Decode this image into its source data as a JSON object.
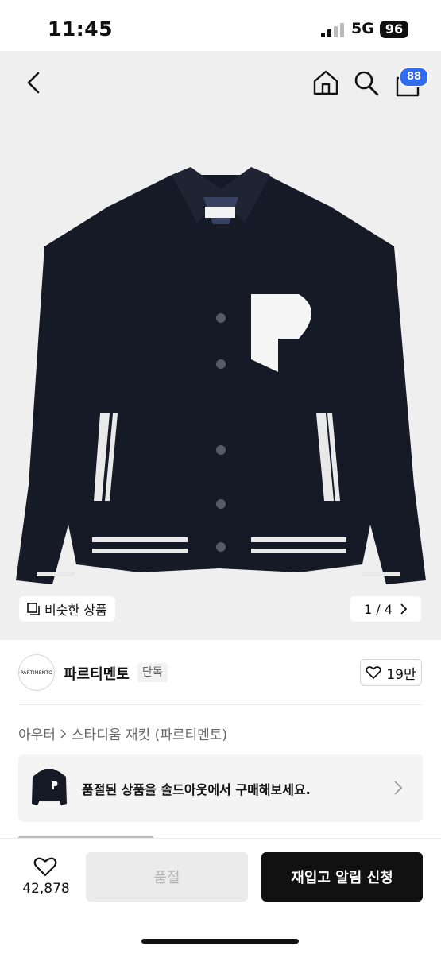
{
  "status_bar": {
    "time": "11:45",
    "network": "5G",
    "battery": "96"
  },
  "nav": {
    "cart_count": "88"
  },
  "gallery": {
    "similar_label": "비슷한 상품",
    "counter": "1 / 4"
  },
  "brand": {
    "name": "파르티멘토",
    "logo_text": "PARTIMENTO",
    "badge": "단독",
    "likes": "19만"
  },
  "breadcrumb": {
    "category": "아우터",
    "product": "스타디움 재킷 (파르티멘토)"
  },
  "soldout_banner": {
    "text": "품절된 상품을 솔드아웃에서 구매해보세요."
  },
  "bottom_bar": {
    "wish_count": "42,878",
    "soldout_label": "품절",
    "restock_label": "재입고 알림 신청"
  },
  "colors": {
    "accent": "#2f6cf0",
    "primary_button": "#111111"
  }
}
